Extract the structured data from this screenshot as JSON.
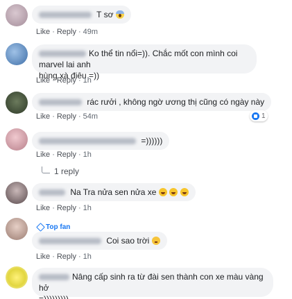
{
  "actions": {
    "like": "Like",
    "reply": "Reply",
    "sep": "·"
  },
  "comments": [
    {
      "text": "T sơ",
      "emoji": "scream-icon",
      "time": "49m"
    },
    {
      "text_line1": "Ko thể tin nổi=)). Chắc mốt con mình coi marvel lai anh",
      "text_line2": "hùng xà điêu =))",
      "time": "1h"
    },
    {
      "text": "rác rưởi , không ngờ ương thị cũng có ngày này",
      "time": "54m",
      "reaction_count": "1"
    },
    {
      "text": "=))))))",
      "time": "1h",
      "replies_label": "1 reply"
    },
    {
      "text": "Na Tra nửa sen nửa xe",
      "emoji_count": 3,
      "time": "1h"
    },
    {
      "badge": "Top fan",
      "text": "Coi sao trời",
      "time": "1h"
    },
    {
      "text_line1": "Nâng cấp sinh ra từ đài sen thành con xe màu vàng hở",
      "text_line2": "=)))))))))"
    }
  ],
  "colors": {
    "bubble": "#f2f3f5",
    "link": "#4b4f56",
    "accent": "#1877f2"
  }
}
